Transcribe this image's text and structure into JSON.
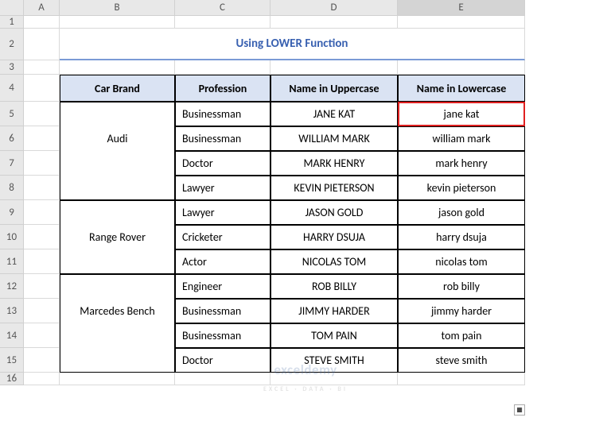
{
  "columns": [
    "",
    "A",
    "B",
    "C",
    "D",
    "E"
  ],
  "selectedColumn": "E",
  "title": "Using LOWER Function",
  "headers": {
    "brand": "Car Brand",
    "profession": "Profession",
    "upper": "Name in Uppercase",
    "lower": "Name in Lowercase"
  },
  "rows": [
    {
      "n": 5,
      "brand": "",
      "profession": "Businessman",
      "upper": "JANE KAT",
      "lower": "jane kat",
      "highlight": true
    },
    {
      "n": 6,
      "brand": "Audi",
      "profession": "Businessman",
      "upper": "WILLIAM MARK",
      "lower": "william mark"
    },
    {
      "n": 7,
      "brand": "",
      "profession": "Doctor",
      "upper": "MARK HENRY",
      "lower": "mark henry"
    },
    {
      "n": 8,
      "brand": "",
      "profession": "Lawyer",
      "upper": "KEVIN PIETERSON",
      "lower": "kevin pieterson"
    },
    {
      "n": 9,
      "brand": "",
      "profession": "Lawyer",
      "upper": "JASON GOLD",
      "lower": "jason gold"
    },
    {
      "n": 10,
      "brand": "Range Rover",
      "profession": "Cricketer",
      "upper": "HARRY DSUJA",
      "lower": "harry dsuja"
    },
    {
      "n": 11,
      "brand": "",
      "profession": "Actor",
      "upper": "NICOLAS TOM",
      "lower": "nicolas tom"
    },
    {
      "n": 12,
      "brand": "",
      "profession": "Engineer",
      "upper": "ROB BILLY",
      "lower": "rob billy"
    },
    {
      "n": 13,
      "brand": "Marcedes Bench",
      "profession": "Businessman",
      "upper": "JIMMY HARDER",
      "lower": "jimmy harder"
    },
    {
      "n": 14,
      "brand": "",
      "profession": "Businessman",
      "upper": "TOM PAIN",
      "lower": "tom pain"
    },
    {
      "n": 15,
      "brand": "",
      "profession": "Doctor",
      "upper": "STEVE SMITH",
      "lower": "steve smith"
    }
  ],
  "brandGroups": [
    {
      "label": "Audi",
      "start": 5,
      "end": 8,
      "labelRow": 6
    },
    {
      "label": "Range Rover",
      "start": 9,
      "end": 11,
      "labelRow": 10
    },
    {
      "label": "Marcedes Bench",
      "start": 12,
      "end": 15,
      "labelRow": 13
    }
  ],
  "watermark": {
    "main": "exceldemy",
    "sub": "EXCEL · DATA · BI"
  }
}
